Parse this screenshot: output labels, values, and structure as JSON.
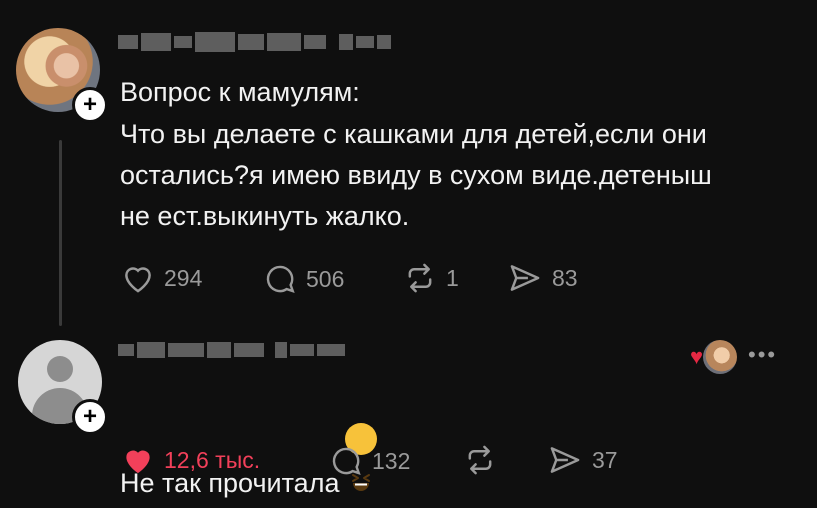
{
  "post": {
    "author_blurred": true,
    "title_line": "Вопрос к мамулям:",
    "body": "Что вы делаете с кашками для детей,если они\nостались?я имею ввиду в сухом виде.детеныш\nне ест.выкинуть жалко.",
    "likes": "294",
    "comments": "506",
    "reposts": "1",
    "shares": "83"
  },
  "reply": {
    "author_blurred": true,
    "text": "Не так прочитала",
    "emoji": "grinning-squinting-face",
    "likes": "12,6 тыс.",
    "comments": "132",
    "shares": "37",
    "more_label": "•••"
  },
  "icons": {
    "plus": "+",
    "heart_outline": "heart-icon",
    "heart_filled": "heart-filled-icon",
    "comment": "comment-icon",
    "repost": "repost-icon",
    "share": "share-icon"
  },
  "colors": {
    "background": "#0f0f0f",
    "text": "#f2f2f2",
    "muted": "#9a9a9a",
    "like_red": "#f2405a"
  }
}
